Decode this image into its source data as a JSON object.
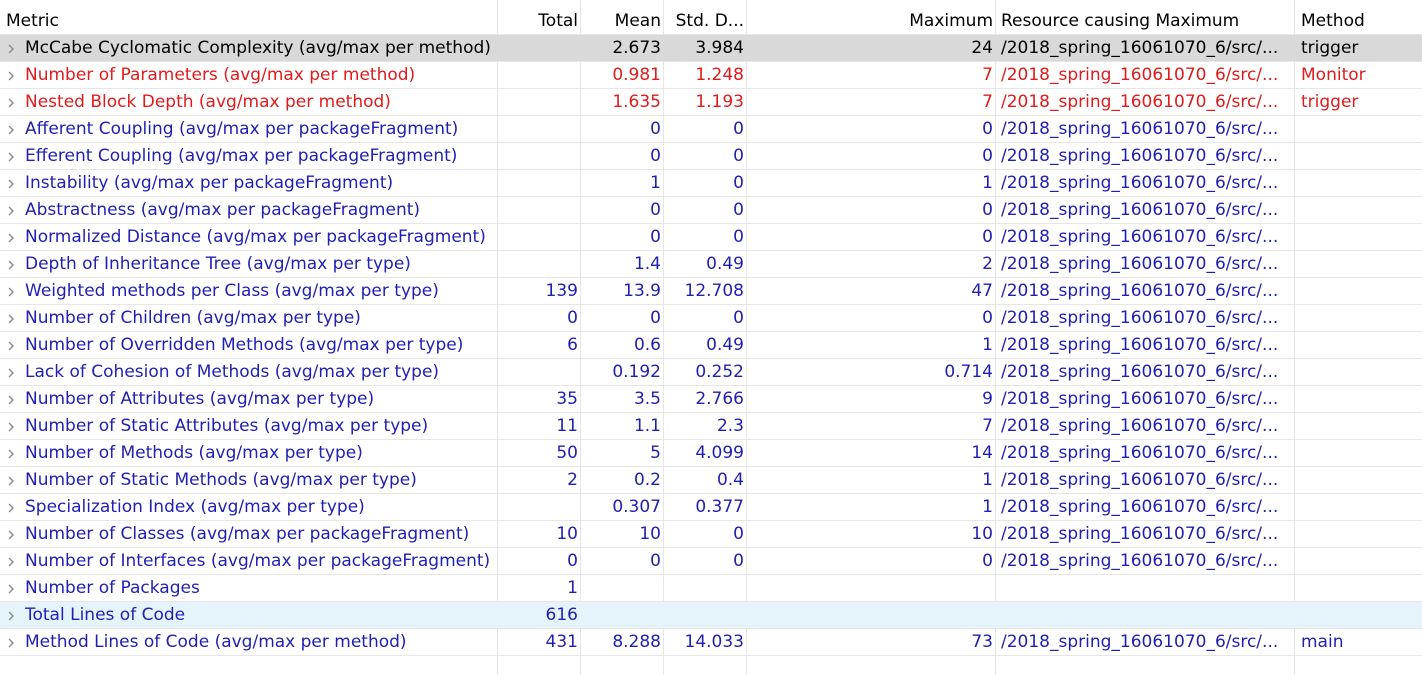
{
  "header": {
    "metric": "Metric",
    "total": "Total",
    "mean": "Mean",
    "std": "Std. D...",
    "max": "Maximum",
    "resource": "Resource causing Maximum",
    "method": "Method"
  },
  "colors": {
    "normal": "#1f1fb3",
    "warning": "#e01b1b",
    "selected_text": "#000000",
    "selected_bg": "#d9d9d9",
    "hover_bg": "#e5f3fb",
    "gridline": "#e6e6e6"
  },
  "rows": [
    {
      "metric": "McCabe Cyclomatic Complexity (avg/max per method)",
      "total": "",
      "mean": "2.673",
      "std": "3.984",
      "max": "24",
      "resource": "/2018_spring_16061070_6/src/...",
      "method": "trigger",
      "state": "selected"
    },
    {
      "metric": "Number of Parameters (avg/max per method)",
      "total": "",
      "mean": "0.981",
      "std": "1.248",
      "max": "7",
      "resource": "/2018_spring_16061070_6/src/...",
      "method": "Monitor",
      "state": "warning"
    },
    {
      "metric": "Nested Block Depth (avg/max per method)",
      "total": "",
      "mean": "1.635",
      "std": "1.193",
      "max": "7",
      "resource": "/2018_spring_16061070_6/src/...",
      "method": "trigger",
      "state": "warning"
    },
    {
      "metric": "Afferent Coupling (avg/max per packageFragment)",
      "total": "",
      "mean": "0",
      "std": "0",
      "max": "0",
      "resource": "/2018_spring_16061070_6/src/...",
      "method": "",
      "state": "normal"
    },
    {
      "metric": "Efferent Coupling (avg/max per packageFragment)",
      "total": "",
      "mean": "0",
      "std": "0",
      "max": "0",
      "resource": "/2018_spring_16061070_6/src/...",
      "method": "",
      "state": "normal"
    },
    {
      "metric": "Instability (avg/max per packageFragment)",
      "total": "",
      "mean": "1",
      "std": "0",
      "max": "1",
      "resource": "/2018_spring_16061070_6/src/...",
      "method": "",
      "state": "normal"
    },
    {
      "metric": "Abstractness (avg/max per packageFragment)",
      "total": "",
      "mean": "0",
      "std": "0",
      "max": "0",
      "resource": "/2018_spring_16061070_6/src/...",
      "method": "",
      "state": "normal"
    },
    {
      "metric": "Normalized Distance (avg/max per packageFragment)",
      "total": "",
      "mean": "0",
      "std": "0",
      "max": "0",
      "resource": "/2018_spring_16061070_6/src/...",
      "method": "",
      "state": "normal"
    },
    {
      "metric": "Depth of Inheritance Tree (avg/max per type)",
      "total": "",
      "mean": "1.4",
      "std": "0.49",
      "max": "2",
      "resource": "/2018_spring_16061070_6/src/...",
      "method": "",
      "state": "normal"
    },
    {
      "metric": "Weighted methods per Class (avg/max per type)",
      "total": "139",
      "mean": "13.9",
      "std": "12.708",
      "max": "47",
      "resource": "/2018_spring_16061070_6/src/...",
      "method": "",
      "state": "normal"
    },
    {
      "metric": "Number of Children (avg/max per type)",
      "total": "0",
      "mean": "0",
      "std": "0",
      "max": "0",
      "resource": "/2018_spring_16061070_6/src/...",
      "method": "",
      "state": "normal"
    },
    {
      "metric": "Number of Overridden Methods (avg/max per type)",
      "total": "6",
      "mean": "0.6",
      "std": "0.49",
      "max": "1",
      "resource": "/2018_spring_16061070_6/src/...",
      "method": "",
      "state": "normal"
    },
    {
      "metric": "Lack of Cohesion of Methods (avg/max per type)",
      "total": "",
      "mean": "0.192",
      "std": "0.252",
      "max": "0.714",
      "resource": "/2018_spring_16061070_6/src/...",
      "method": "",
      "state": "normal"
    },
    {
      "metric": "Number of Attributes (avg/max per type)",
      "total": "35",
      "mean": "3.5",
      "std": "2.766",
      "max": "9",
      "resource": "/2018_spring_16061070_6/src/...",
      "method": "",
      "state": "normal"
    },
    {
      "metric": "Number of Static Attributes (avg/max per type)",
      "total": "11",
      "mean": "1.1",
      "std": "2.3",
      "max": "7",
      "resource": "/2018_spring_16061070_6/src/...",
      "method": "",
      "state": "normal"
    },
    {
      "metric": "Number of Methods (avg/max per type)",
      "total": "50",
      "mean": "5",
      "std": "4.099",
      "max": "14",
      "resource": "/2018_spring_16061070_6/src/...",
      "method": "",
      "state": "normal"
    },
    {
      "metric": "Number of Static Methods (avg/max per type)",
      "total": "2",
      "mean": "0.2",
      "std": "0.4",
      "max": "1",
      "resource": "/2018_spring_16061070_6/src/...",
      "method": "",
      "state": "normal"
    },
    {
      "metric": "Specialization Index (avg/max per type)",
      "total": "",
      "mean": "0.307",
      "std": "0.377",
      "max": "1",
      "resource": "/2018_spring_16061070_6/src/...",
      "method": "",
      "state": "normal"
    },
    {
      "metric": "Number of Classes (avg/max per packageFragment)",
      "total": "10",
      "mean": "10",
      "std": "0",
      "max": "10",
      "resource": "/2018_spring_16061070_6/src/...",
      "method": "",
      "state": "normal"
    },
    {
      "metric": "Number of Interfaces (avg/max per packageFragment)",
      "total": "0",
      "mean": "0",
      "std": "0",
      "max": "0",
      "resource": "/2018_spring_16061070_6/src/...",
      "method": "",
      "state": "normal"
    },
    {
      "metric": "Number of Packages",
      "total": "1",
      "mean": "",
      "std": "",
      "max": "",
      "resource": "",
      "method": "",
      "state": "normal"
    },
    {
      "metric": "Total Lines of Code",
      "total": "616",
      "mean": "",
      "std": "",
      "max": "",
      "resource": "",
      "method": "",
      "state": "hover"
    },
    {
      "metric": "Method Lines of Code (avg/max per method)",
      "total": "431",
      "mean": "8.288",
      "std": "14.033",
      "max": "73",
      "resource": "/2018_spring_16061070_6/src/...",
      "method": "main",
      "state": "normal"
    }
  ]
}
